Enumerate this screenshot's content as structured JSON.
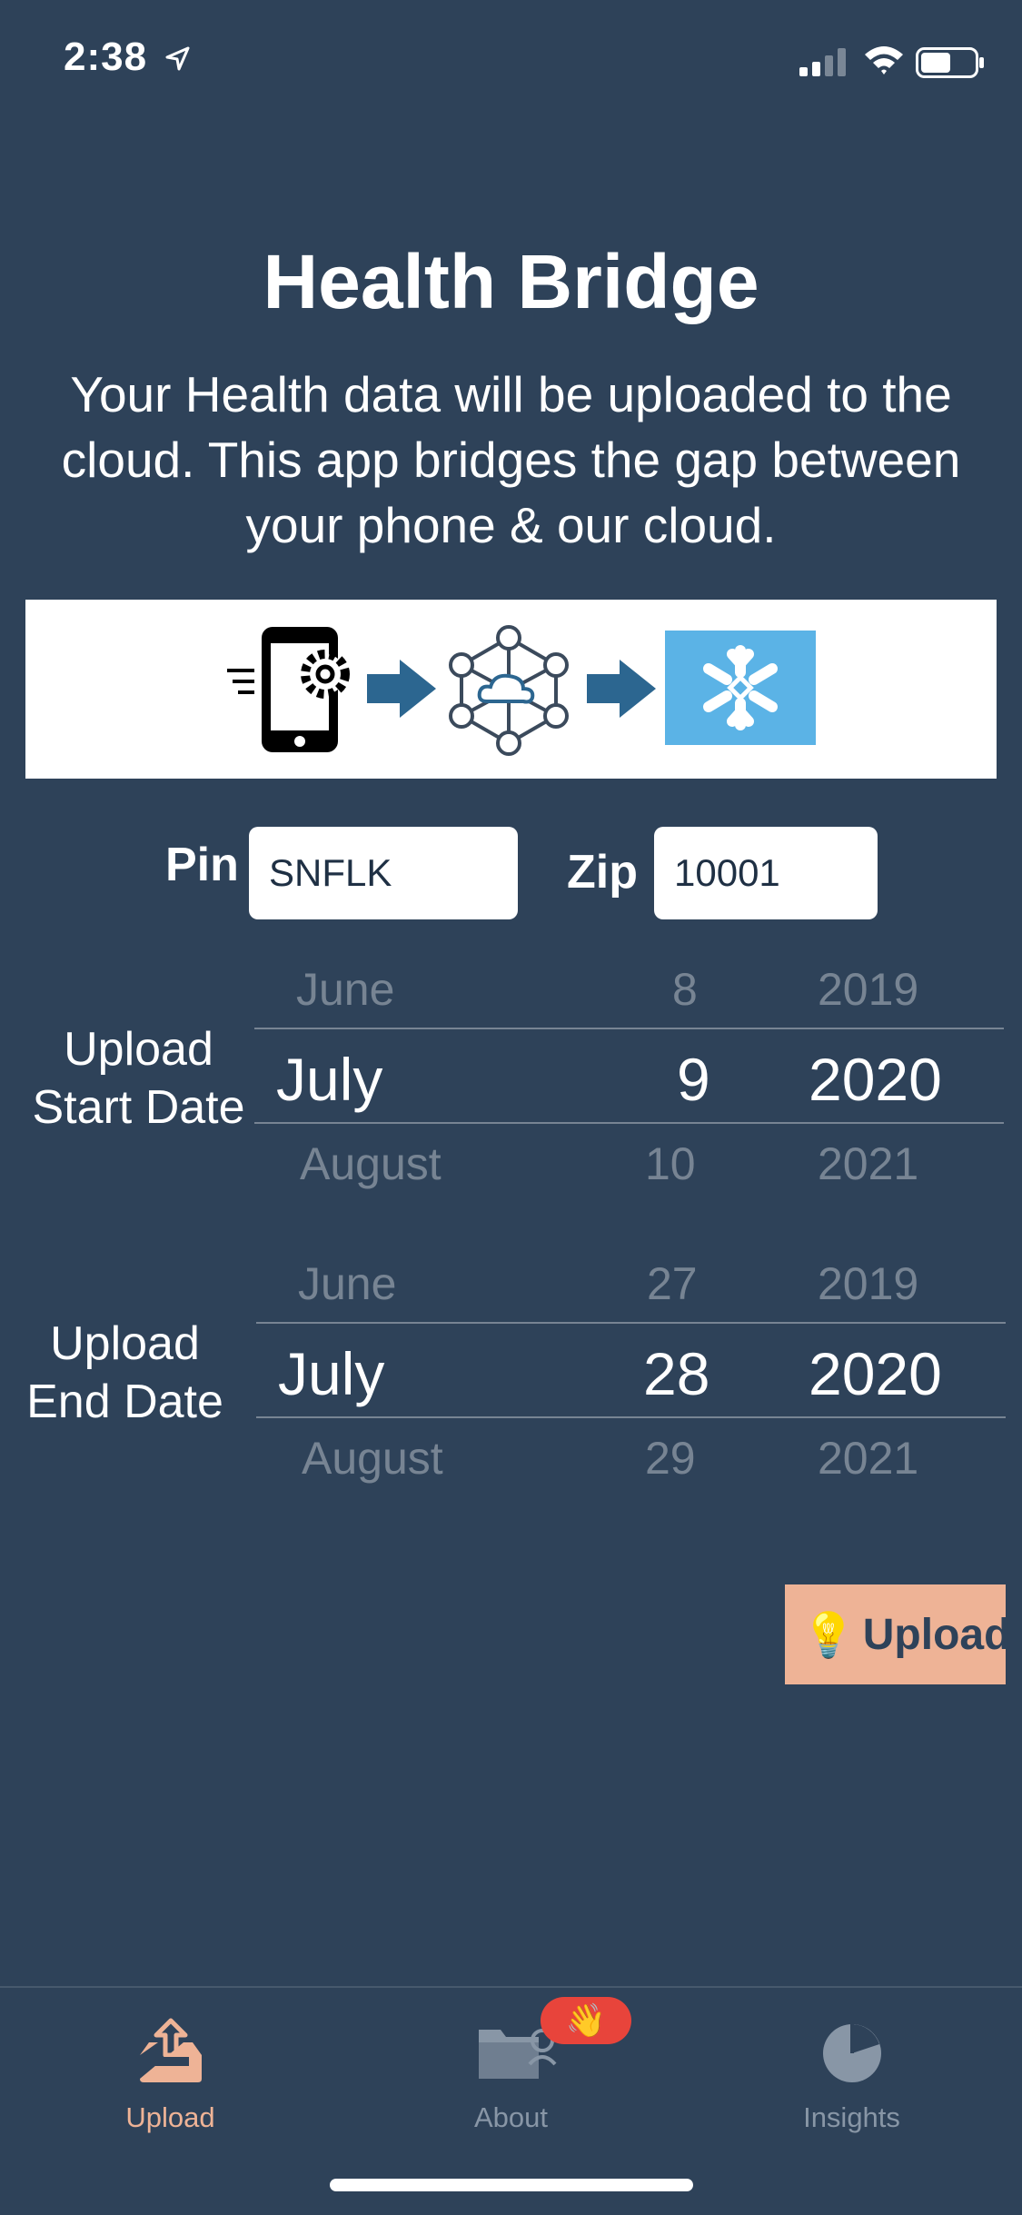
{
  "status_bar": {
    "time": "2:38"
  },
  "header": {
    "title": "Health Bridge",
    "subtitle": "Your Health data will be uploaded to the cloud. This app bridges the gap between your phone & our cloud."
  },
  "form": {
    "pin_label": "Pin",
    "pin_value": "SNFLK",
    "zip_label": "Zip",
    "zip_value": "10001"
  },
  "start_picker": {
    "label_line1": "Upload",
    "label_line2": "Start Date",
    "month": {
      "prev": "June",
      "selected": "July",
      "next": "August"
    },
    "day": {
      "prev": "8",
      "selected": "9",
      "next": "10"
    },
    "year": {
      "prev": "2019",
      "selected": "2020",
      "next": "2021"
    }
  },
  "end_picker": {
    "label_line1": "Upload",
    "label_line2": "End Date",
    "month": {
      "prev": "June",
      "selected": "July",
      "next": "August"
    },
    "day": {
      "prev": "27",
      "selected": "28",
      "next": "29"
    },
    "year": {
      "prev": "2019",
      "selected": "2020",
      "next": "2021"
    }
  },
  "actions": {
    "upload_emoji": "💡",
    "upload_label": "Upload"
  },
  "tabbar": {
    "tabs": [
      {
        "label": "Upload",
        "icon": "upload-tray-icon",
        "active": true
      },
      {
        "label": "About",
        "icon": "folder-person-icon",
        "active": false
      },
      {
        "label": "Insights",
        "icon": "pie-chart-icon",
        "active": false
      }
    ],
    "badge_emoji": "👋"
  },
  "colors": {
    "background": "#2e4259",
    "accent": "#eeb396",
    "badge": "#e8443b",
    "arrow": "#2c6690",
    "snowflake_bg": "#5bb3e6"
  }
}
